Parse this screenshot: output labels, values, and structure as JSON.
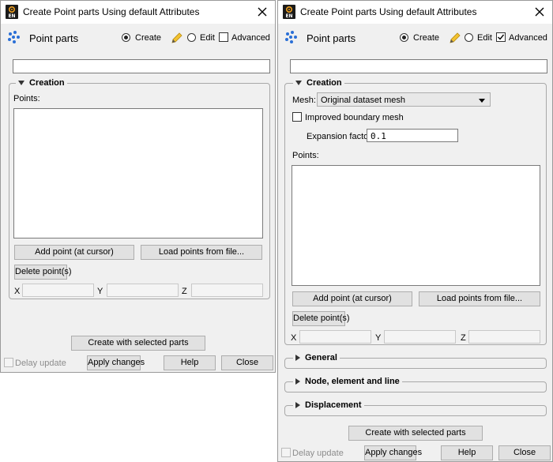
{
  "dialogs": [
    {
      "title": "Create Point parts Using default Attributes",
      "header_title": "Point parts",
      "mode_create": "Create",
      "mode_edit": "Edit",
      "advanced_label": "Advanced",
      "advanced_checked": false,
      "name_value": "",
      "creation_caption": "Creation",
      "points_label": "Points:",
      "add_point": "Add point (at cursor)",
      "load_points": "Load points from file...",
      "delete_point": "Delete point(s)",
      "x_label": "X",
      "y_label": "Y",
      "z_label": "Z",
      "create_selected": "Create with selected parts",
      "delay_update": "Delay update",
      "apply_changes": "Apply changes",
      "help": "Help",
      "close": "Close"
    },
    {
      "title": "Create Point parts Using default Attributes",
      "header_title": "Point parts",
      "mode_create": "Create",
      "mode_edit": "Edit",
      "advanced_label": "Advanced",
      "advanced_checked": true,
      "name_value": "",
      "creation_caption": "Creation",
      "mesh_label": "Mesh:",
      "mesh_value": "Original dataset mesh",
      "improved_boundary": "Improved boundary mesh",
      "expansion_label": "Expansion factor",
      "expansion_value": "0.1",
      "points_label": "Points:",
      "add_point": "Add point (at cursor)",
      "load_points": "Load points from file...",
      "delete_point": "Delete point(s)",
      "x_label": "X",
      "y_label": "Y",
      "z_label": "Z",
      "general_caption": "General",
      "node_caption": "Node, element and line",
      "displacement_caption": "Displacement",
      "create_selected": "Create with selected parts",
      "delay_update": "Delay update",
      "apply_changes": "Apply changes",
      "help": "Help",
      "close": "Close"
    }
  ]
}
